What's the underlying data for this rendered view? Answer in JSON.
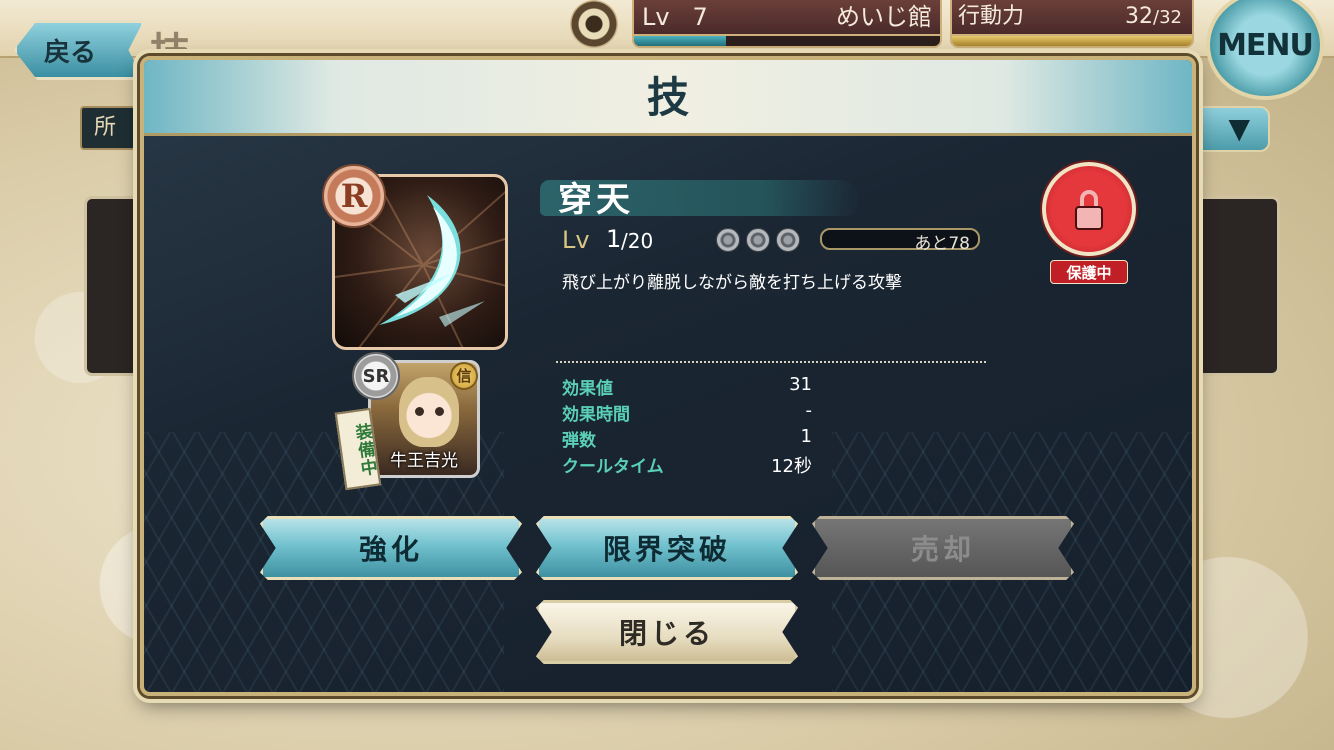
{
  "header": {
    "back_label": "戻る",
    "screen_title": "技",
    "level_label": "Lv",
    "level_value": "7",
    "player_name": "めいじ館",
    "ap_label": "行動力",
    "ap_current": "32",
    "ap_max": "/32",
    "menu_label": "MENU",
    "level_exp_fraction": 0.3,
    "ap_fraction": 1.0
  },
  "background": {
    "tab_label": "所",
    "dropdown_icon": "triangle-down-icon"
  },
  "modal": {
    "title": "技",
    "skill": {
      "rarity": "R",
      "name": "穿天",
      "level_label": "Lv",
      "level_current": "1",
      "level_max": "/20",
      "stars_total": 3,
      "exp_remaining": "あと78",
      "description": "飛び上がり離脱しながら敵を打ち上げる攻撃",
      "stats": [
        {
          "label": "効果値",
          "value": "31"
        },
        {
          "label": "効果時間",
          "value": "-"
        },
        {
          "label": "弾数",
          "value": "1"
        },
        {
          "label": "クールタイム",
          "value": "12秒"
        }
      ]
    },
    "character": {
      "rarity": "SR",
      "faction_badge": "信",
      "equip_tag": "装備中",
      "name": "牛王吉光"
    },
    "lock_label": "保護中",
    "buttons": {
      "enhance": "強化",
      "limit_break": "限界突破",
      "sell": "売却",
      "close": "閉じる"
    }
  },
  "colors": {
    "accent_teal": "#3a8c9d",
    "stat_label": "#5ad0b6",
    "lock_red": "#e4383c",
    "frame_gold": "#c9b27a"
  }
}
